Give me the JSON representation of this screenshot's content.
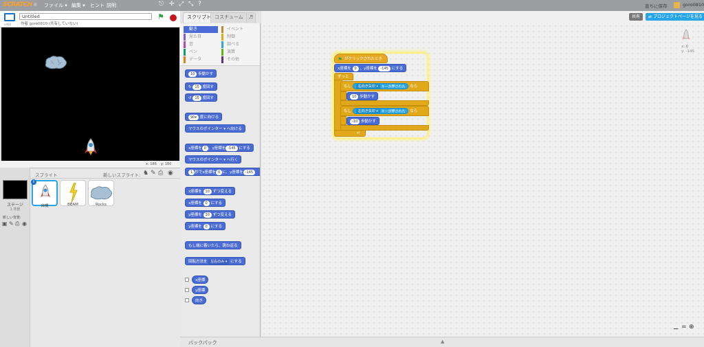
{
  "topbar": {
    "logo": "SCRATCH",
    "menu_file": "ファイル ▾",
    "menu_edit": "編集 ▾",
    "menu_hint": "ヒント",
    "menu_about": "説明",
    "save_now": "直ちに保存",
    "username": "goro0810"
  },
  "stage_header": {
    "project_title": "Untitled",
    "author": "作者 goro0810 (共有していない)",
    "version": "v460"
  },
  "stage": {
    "coords_x": "x: 186",
    "coords_y": "y: 180"
  },
  "sprite_pane": {
    "sprites_label": "スプライト",
    "new_sprite_label": "新しいスプライト:",
    "stage_label": "ステージ",
    "stage_backdrops": "1 背景",
    "new_backdrop_label": "新しい背景:",
    "sprites": [
      {
        "name": "自機",
        "selected": true
      },
      {
        "name": "BEAM",
        "selected": false
      },
      {
        "name": "Rocks",
        "selected": false
      }
    ]
  },
  "tabs": {
    "scripts": "スクリプト",
    "costumes": "コスチューム",
    "sounds": "音"
  },
  "categories": {
    "motion": "動き",
    "looks": "見た目",
    "sound": "音",
    "pen": "ペン",
    "data": "データ",
    "events": "イベント",
    "control": "制御",
    "sensing": "調べる",
    "operators": "演算",
    "more": "その他"
  },
  "palette": {
    "move": "歩動かす",
    "move_val": "10",
    "turn_right": "度回す",
    "turn_right_val": "15",
    "turn_left": "度回す",
    "turn_left_val": "15",
    "point_dir": "度に向ける",
    "point_dir_val": "90▾",
    "point_towards": "マウスのポインター ▾ へ向ける",
    "goto_xy_1": "x座標を",
    "goto_xy_x": "0",
    "goto_xy_2": "、y座標を",
    "goto_xy_y": "-145",
    "goto_xy_3": "にする",
    "goto": "マウスのポインター ▾ へ行く",
    "glide_1": "秒でx座標を",
    "glide_secs": "1",
    "glide_x": "0",
    "glide_2": "に、y座標を",
    "glide_y": "-145",
    "change_x_1": "x座標を",
    "change_x_val": "10",
    "change_x_2": "ずつ変える",
    "set_x_1": "x座標を",
    "set_x_val": "0",
    "set_x_2": "にする",
    "change_y_1": "y座標を",
    "change_y_val": "10",
    "change_y_2": "ずつ変える",
    "set_y_1": "y座標を",
    "set_y_val": "0",
    "set_y_2": "にする",
    "bounce": "もし端に着いたら、跳ね返る",
    "rotation_1": "回転方法を",
    "rotation_val": "左右のみ ▾",
    "rotation_2": "にする",
    "rep_x": "x座標",
    "rep_y": "y座標",
    "rep_dir": "向き"
  },
  "sprite_info": {
    "x": "x: 0",
    "y": "y: -145"
  },
  "right_header": {
    "share": "共有",
    "see_project_page": "プロジェクトページを見る"
  },
  "script": {
    "hat": "がクリックされたとき",
    "goto_1": "x座標を",
    "goto_x": "0",
    "goto_2": "、y座標を",
    "goto_y": "-145",
    "goto_3": "にする",
    "forever": "ずっと",
    "if1_label": "もし",
    "if1_key": "右向き矢印 ▾",
    "if1_pressed": "キーが押された",
    "if1_then": "なら",
    "move1_val": "10",
    "move1_label": "歩動かす",
    "if2_label": "もし",
    "if2_key": "左向き矢印 ▾",
    "if2_pressed": "キーが押された",
    "if2_then": "なら",
    "move2_val": "-10",
    "move2_label": "歩動かす"
  },
  "backpack": {
    "label": "バックパック"
  },
  "colors": {
    "motion": "#4a6cd4",
    "control": "#e1a91a",
    "events": "#e6a822",
    "sensing": "#2ca5e2",
    "topbar": "#9c9ea2",
    "share_button": "#28a4e8"
  }
}
